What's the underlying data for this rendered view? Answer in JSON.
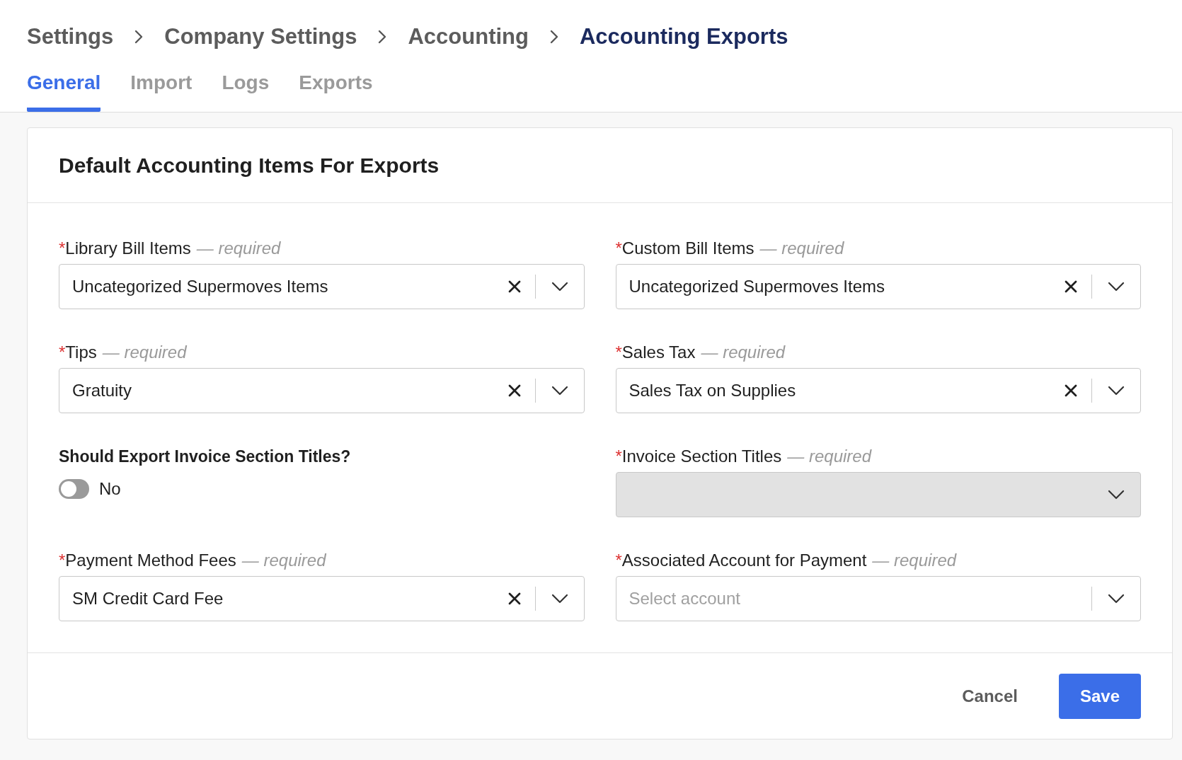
{
  "breadcrumb": [
    {
      "label": "Settings",
      "current": false
    },
    {
      "label": "Company Settings",
      "current": false
    },
    {
      "label": "Accounting",
      "current": false
    },
    {
      "label": "Accounting Exports",
      "current": true
    }
  ],
  "tabs": [
    {
      "label": "General",
      "selected": true
    },
    {
      "label": "Import",
      "selected": false
    },
    {
      "label": "Logs",
      "selected": false
    },
    {
      "label": "Exports",
      "selected": false
    }
  ],
  "card": {
    "title": "Default Accounting Items For Exports",
    "fields": [
      {
        "kind": "select",
        "mark": "*",
        "label": "Library Bill Items",
        "hint": "— required",
        "value": "Uncategorized Supermoves Items",
        "clearable": true,
        "disabled": false
      },
      {
        "kind": "select",
        "mark": "*",
        "label": "Custom Bill Items",
        "hint": "— required",
        "value": "Uncategorized Supermoves Items",
        "clearable": true,
        "disabled": false
      },
      {
        "kind": "select",
        "mark": "*",
        "label": "Tips",
        "hint": "— required",
        "value": "Gratuity",
        "clearable": true,
        "disabled": false
      },
      {
        "kind": "select",
        "mark": "*",
        "label": "Sales Tax",
        "hint": "— required",
        "value": "Sales Tax on Supplies",
        "clearable": true,
        "disabled": false
      },
      {
        "kind": "toggle",
        "label": "Should Export Invoice Section Titles?",
        "on": false,
        "state_label": "No"
      },
      {
        "kind": "select",
        "mark": "*",
        "label": "Invoice Section Titles",
        "hint": "— required",
        "clearable": false,
        "disabled": true
      },
      {
        "kind": "select",
        "mark": "*",
        "label": "Payment Method Fees",
        "hint": "— required",
        "value": "SM Credit Card Fee",
        "clearable": true,
        "disabled": false
      },
      {
        "kind": "select",
        "mark": "*",
        "label": "Associated Account for Payment",
        "hint": "— required",
        "placeholder": "Select account",
        "clearable": false,
        "disabled": false
      }
    ],
    "buttons": [
      {
        "label": "Cancel",
        "kind": "secondary"
      },
      {
        "label": "Save",
        "kind": "primary"
      }
    ]
  }
}
